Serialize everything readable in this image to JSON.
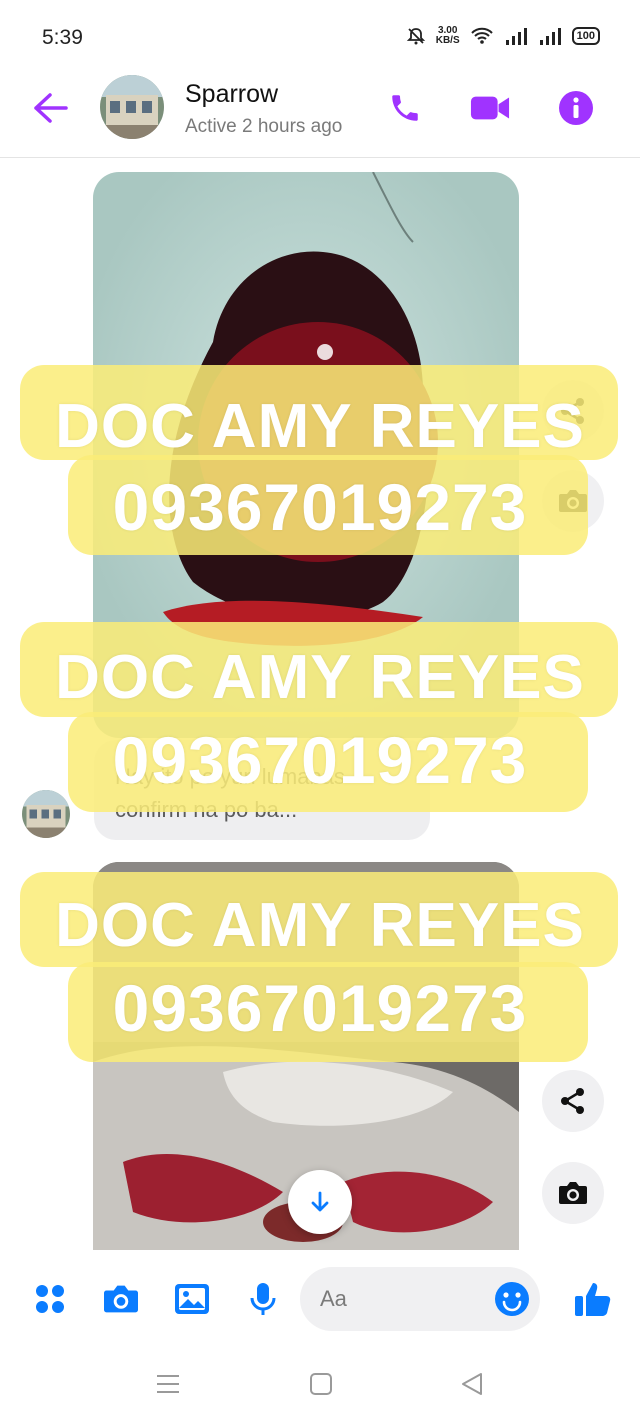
{
  "status_bar": {
    "time": "5:39",
    "speed_value": "3.00",
    "speed_unit": "KB/S",
    "battery": "100"
  },
  "header": {
    "contact_name": "Sparrow",
    "contact_status": "Active 2 hours ago",
    "accent_color": "#a033ff"
  },
  "messages": {
    "text": "Nay ito po yun lumabas confirm na po ba..."
  },
  "watermarks": [
    {
      "line1": "DOC AMY REYES",
      "line2": "09367019273"
    },
    {
      "line1": "DOC AMY REYES",
      "line2": "09367019273"
    },
    {
      "line1": "DOC AMY REYES",
      "line2": "09367019273"
    }
  ],
  "composer": {
    "placeholder": "Aa",
    "accent_color": "#0a7cff"
  },
  "icons": [
    "back-arrow-icon",
    "phone-icon",
    "video-icon",
    "info-icon",
    "share-icon",
    "camera-icon",
    "menu-dots-icon",
    "image-icon",
    "mic-icon",
    "emoji-icon",
    "thumbs-up-icon",
    "arrow-down-icon"
  ]
}
